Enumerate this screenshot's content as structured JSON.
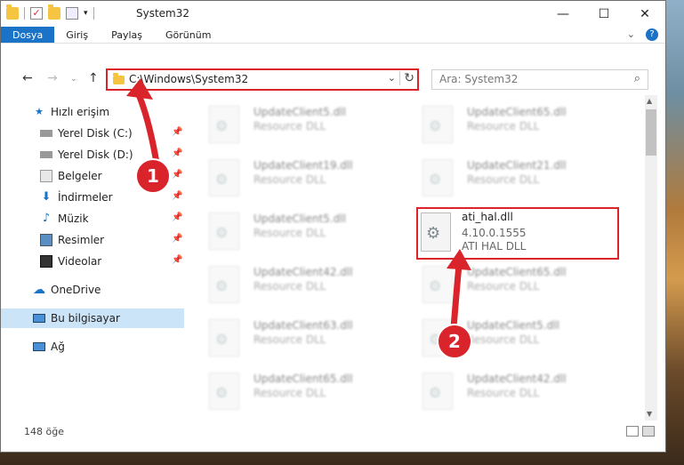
{
  "window": {
    "title": "System32"
  },
  "ribbon": {
    "tabs": [
      {
        "label": "Dosya",
        "active": true
      },
      {
        "label": "Giriş",
        "active": false
      },
      {
        "label": "Paylaş",
        "active": false
      },
      {
        "label": "Görünüm",
        "active": false
      }
    ]
  },
  "nav": {
    "address": "C:\\Windows\\System32",
    "search_placeholder": "Ara: System32"
  },
  "sidebar": {
    "items": [
      {
        "label": "Hızlı erişim",
        "icon": "star-icon"
      },
      {
        "label": "Yerel Disk (C:)",
        "icon": "drive-icon"
      },
      {
        "label": "Yerel Disk (D:)",
        "icon": "drive-icon"
      },
      {
        "label": "Belgeler",
        "icon": "documents-icon"
      },
      {
        "label": "İndirmeler",
        "icon": "download-icon"
      },
      {
        "label": "Müzik",
        "icon": "music-icon"
      },
      {
        "label": "Resimler",
        "icon": "pictures-icon"
      },
      {
        "label": "Videolar",
        "icon": "videos-icon"
      },
      {
        "label": "OneDrive",
        "icon": "cloud-icon"
      },
      {
        "label": "Bu bilgisayar",
        "icon": "computer-icon"
      },
      {
        "label": "Ağ",
        "icon": "network-icon"
      }
    ]
  },
  "files": [
    {
      "name": "UpdateClient5.dll",
      "desc": "Resource DLL"
    },
    {
      "name": "UpdateClient65.dll",
      "desc": "Resource DLL"
    },
    {
      "name": "UpdateClient19.dll",
      "desc": "Resource DLL"
    },
    {
      "name": "UpdateClient21.dll",
      "desc": "Resource DLL"
    },
    {
      "name": "UpdateClient5.dll",
      "desc": "Resource DLL"
    },
    {
      "name": "UpdateClient42.dll",
      "desc": "Resource DLL"
    },
    {
      "name": "UpdateClient65.dll",
      "desc": "Resource DLL"
    },
    {
      "name": "UpdateClient63.dll",
      "desc": "Resource DLL"
    },
    {
      "name": "UpdateClient5.dll",
      "desc": "Resource DLL"
    },
    {
      "name": "UpdateClient65.dll",
      "desc": "Resource DLL"
    },
    {
      "name": "UpdateClient42.dll",
      "desc": "Resource DLL"
    }
  ],
  "highlighted_file": {
    "name": "ati_hal.dll",
    "version": "4.10.0.1555",
    "desc": "ATI HAL DLL"
  },
  "status": {
    "count": "148 öğe"
  },
  "annotations": {
    "badge1": "1",
    "badge2": "2",
    "color": "#d9242b"
  }
}
